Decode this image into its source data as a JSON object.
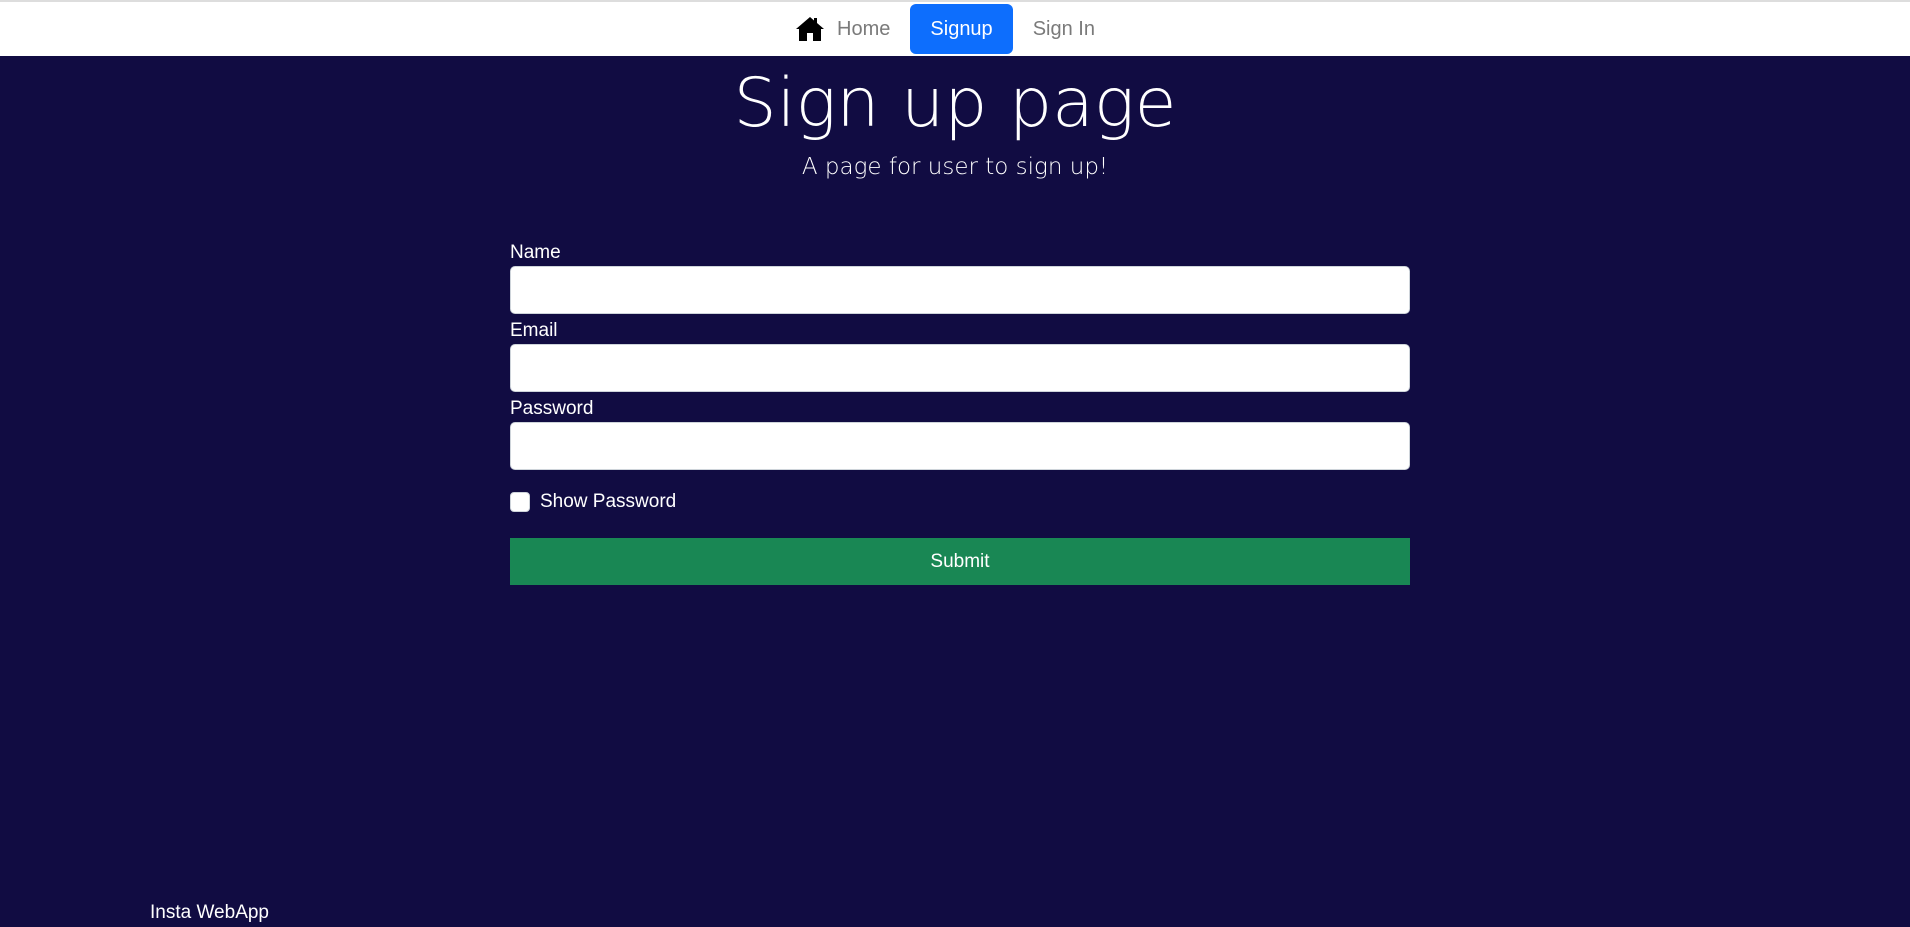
{
  "nav": {
    "home_icon": "home-icon",
    "home_label": "Home",
    "signup_label": "Signup",
    "signin_label": "Sign In",
    "active": "Signup",
    "active_color": "#0d6efd"
  },
  "hero": {
    "title": "Sign up page",
    "subtitle": "A page for user to sign up!"
  },
  "form": {
    "name_label": "Name",
    "name_value": "",
    "email_label": "Email",
    "email_value": "",
    "password_label": "Password",
    "password_value": "",
    "show_password_label": "Show Password",
    "show_password_checked": false,
    "submit_label": "Submit",
    "submit_color": "#198754"
  },
  "footer": {
    "text": "Insta WebApp"
  },
  "colors": {
    "background": "#110c42",
    "navbar": "#ffffff"
  }
}
